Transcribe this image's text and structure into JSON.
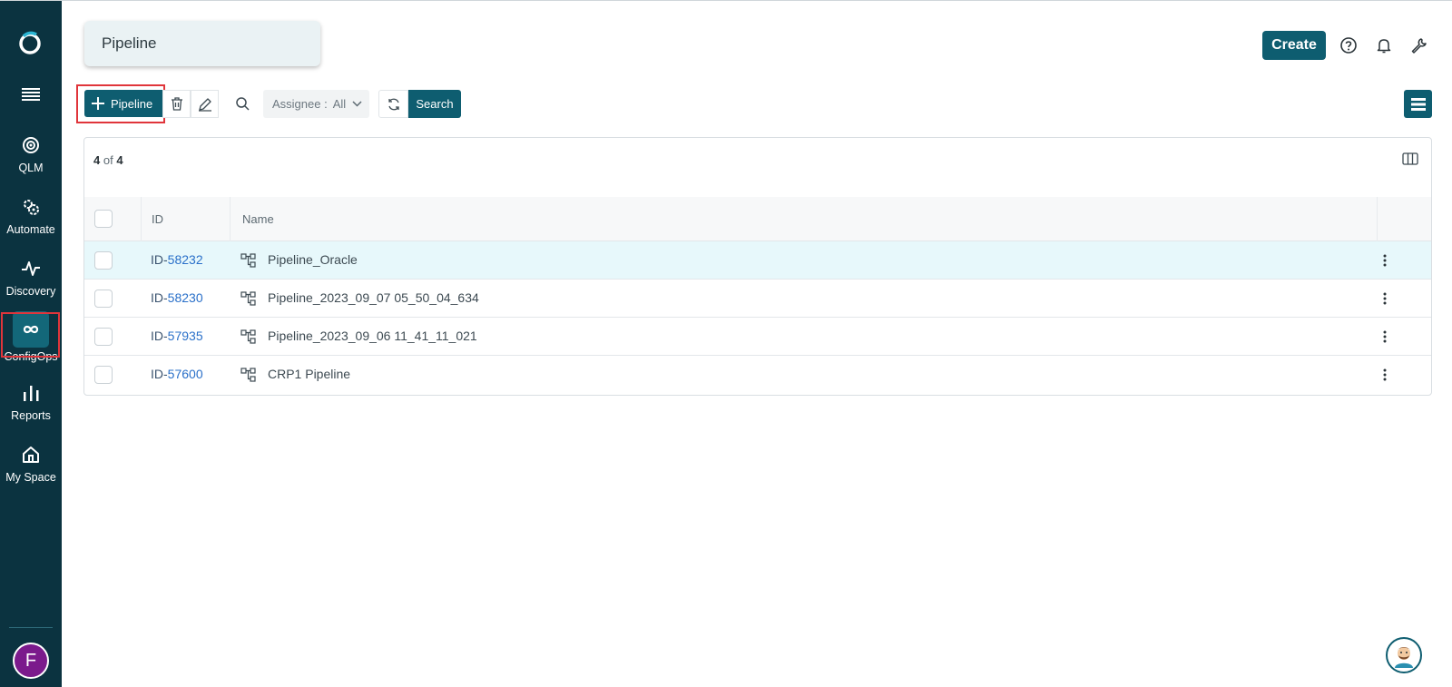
{
  "sidebar": {
    "items": [
      {
        "label": "QLM",
        "icon": "target-icon"
      },
      {
        "label": "Automate",
        "icon": "gears-icon"
      },
      {
        "label": "Discovery",
        "icon": "pulse-icon"
      },
      {
        "label": "ConfigOps",
        "icon": "infinity-icon",
        "active": true
      },
      {
        "label": "Reports",
        "icon": "bar-chart-icon"
      },
      {
        "label": "My Space",
        "icon": "home-icon"
      }
    ],
    "user_initial": "F"
  },
  "page": {
    "title": "Pipeline"
  },
  "header": {
    "create_label": "Create"
  },
  "toolbar": {
    "add_label": "Pipeline",
    "assignee_label": "Assignee :",
    "assignee_value": "All",
    "search_label": "Search"
  },
  "table": {
    "count_shown": "4",
    "count_of": "of",
    "count_total": "4",
    "columns": [
      "ID",
      "Name"
    ],
    "rows": [
      {
        "id_prefix": "ID-",
        "id": "58232",
        "name": "Pipeline_Oracle"
      },
      {
        "id_prefix": "ID-",
        "id": "58230",
        "name": "Pipeline_2023_09_07 05_50_04_634"
      },
      {
        "id_prefix": "ID-",
        "id": "57935",
        "name": "Pipeline_2023_09_06 11_41_11_021"
      },
      {
        "id_prefix": "ID-",
        "id": "57600",
        "name": "CRP1 Pipeline"
      }
    ]
  },
  "colors": {
    "sidebar": "#0b3340",
    "accent": "#0e5d70",
    "highlight": "#e0353b",
    "link": "#2a70c9"
  }
}
